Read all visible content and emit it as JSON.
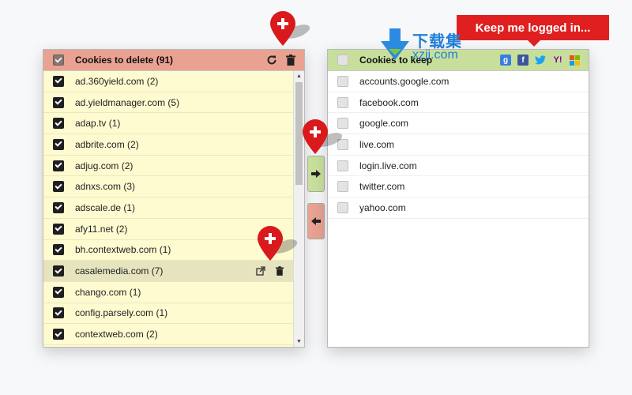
{
  "left_panel": {
    "title": "Cookies to delete (91)",
    "items": [
      {
        "label": "ad.360yield.com (2)"
      },
      {
        "label": "ad.yieldmanager.com (5)"
      },
      {
        "label": "adap.tv (1)"
      },
      {
        "label": "adbrite.com (2)"
      },
      {
        "label": "adjug.com (2)"
      },
      {
        "label": "adnxs.com (3)"
      },
      {
        "label": "adscale.de (1)"
      },
      {
        "label": "afy11.net (2)"
      },
      {
        "label": "bh.contextweb.com (1)"
      },
      {
        "label": "casalemedia.com (7)"
      },
      {
        "label": "chango.com (1)"
      },
      {
        "label": "config.parsely.com (1)"
      },
      {
        "label": "contextweb.com (2)"
      }
    ]
  },
  "right_panel": {
    "title": "Cookies to keep",
    "items": [
      {
        "label": "accounts.google.com"
      },
      {
        "label": "facebook.com"
      },
      {
        "label": "google.com"
      },
      {
        "label": "live.com"
      },
      {
        "label": "login.live.com"
      },
      {
        "label": "twitter.com"
      },
      {
        "label": "yahoo.com"
      }
    ]
  },
  "callout": {
    "text": "Keep me logged in..."
  },
  "watermark": {
    "cn": "下载集",
    "url": "xzji.com"
  },
  "colors": {
    "delete_header": "#e9a292",
    "keep_header": "#c8df9c",
    "list_bg": "#fffbd0",
    "pin_red": "#d9191c"
  },
  "icons": [
    "refresh-icon",
    "trash-icon",
    "arrow-right-icon",
    "arrow-left-icon",
    "google-icon",
    "facebook-icon",
    "twitter-icon",
    "yahoo-icon",
    "windows-icon",
    "plus-pin-icon",
    "external-link-icon"
  ]
}
